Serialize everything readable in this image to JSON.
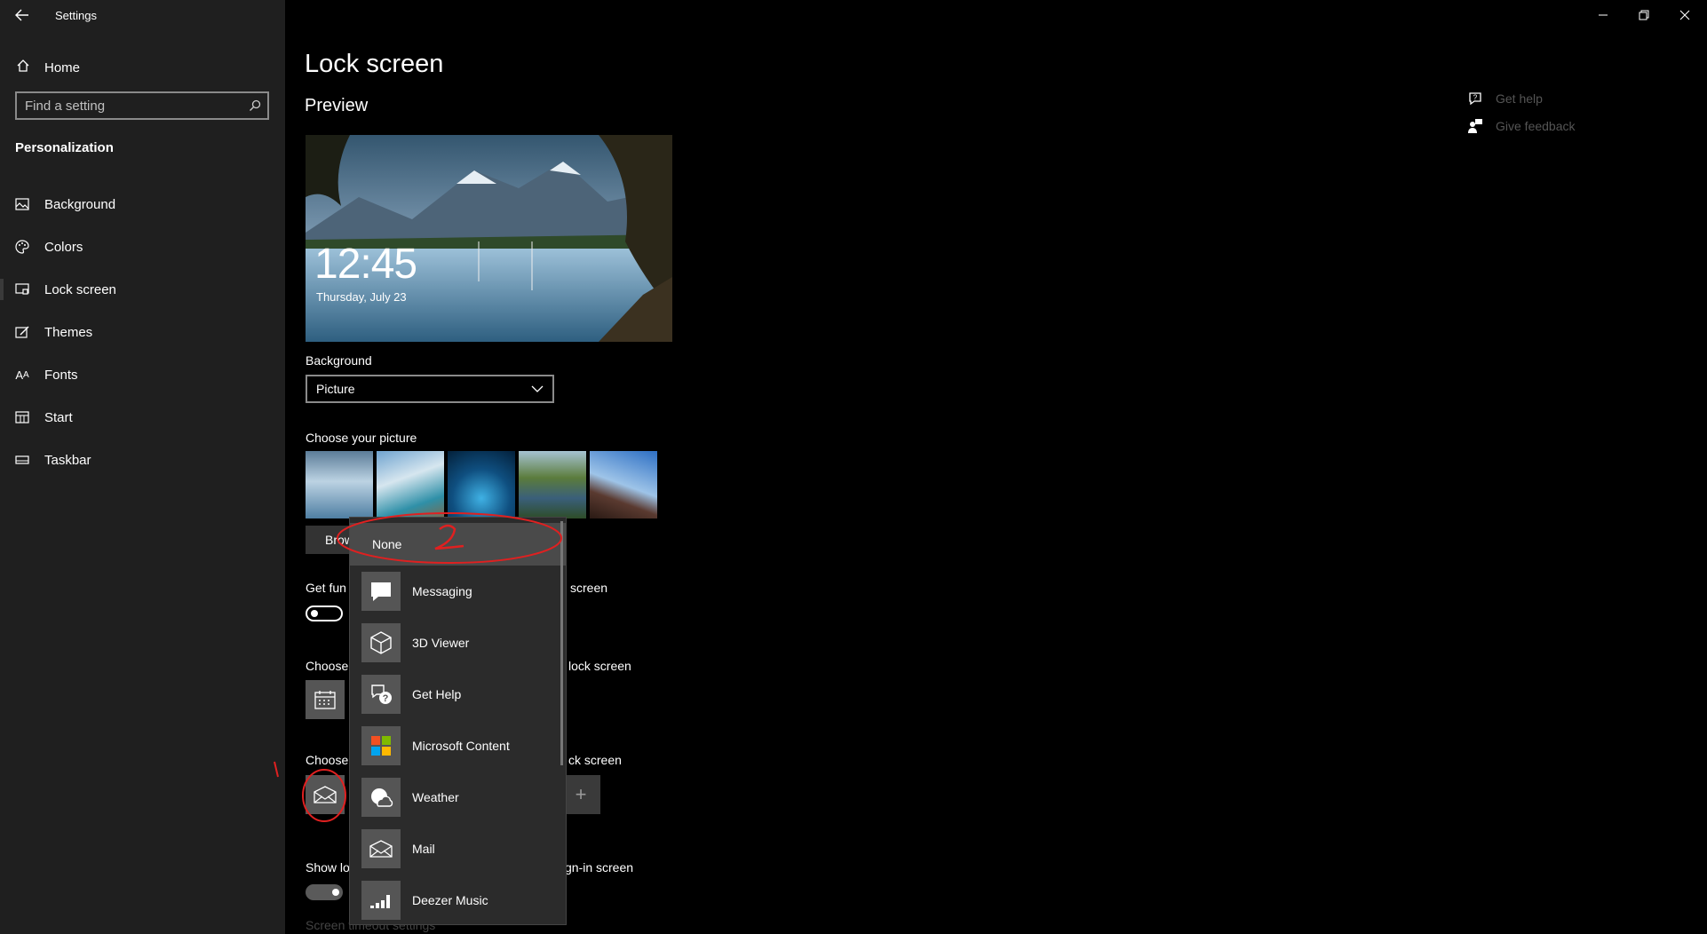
{
  "window": {
    "title": "Settings",
    "minimize_glyph": "—",
    "maximize_glyph": "❐",
    "close_glyph": "✕"
  },
  "sidebar": {
    "home_label": "Home",
    "search_placeholder": "Find a setting",
    "section_title": "Personalization",
    "items": [
      {
        "label": "Background",
        "icon": "image-icon"
      },
      {
        "label": "Colors",
        "icon": "palette-icon"
      },
      {
        "label": "Lock screen",
        "icon": "lock-screen-icon",
        "active": true
      },
      {
        "label": "Themes",
        "icon": "themes-icon"
      },
      {
        "label": "Fonts",
        "icon": "fonts-icon"
      },
      {
        "label": "Start",
        "icon": "start-icon"
      },
      {
        "label": "Taskbar",
        "icon": "taskbar-icon"
      }
    ]
  },
  "main": {
    "title": "Lock screen",
    "preview_label": "Preview",
    "preview_time": "12:45",
    "preview_date": "Thursday, July 23",
    "background_label": "Background",
    "background_value": "Picture",
    "choose_picture_label": "Choose your picture",
    "browse_label": "Browse",
    "get_fun_label_left": "Get fun",
    "get_fun_label_right": "screen",
    "choose_detailed_left": "Choose",
    "choose_detailed_right": "lock screen",
    "choose_quick_left": "Choose",
    "choose_quick_right": "ck screen",
    "show_bg_left": "Show lo",
    "show_bg_right": "gn-in screen",
    "screen_timeout_partial": "Screen timeout settings"
  },
  "right_panel": {
    "get_help": "Get help",
    "give_feedback": "Give feedback"
  },
  "popup": {
    "none_label": "None",
    "items": [
      {
        "label": "Messaging",
        "icon": "messaging-icon"
      },
      {
        "label": "3D Viewer",
        "icon": "3d-viewer-icon"
      },
      {
        "label": "Get Help",
        "icon": "get-help-icon"
      },
      {
        "label": "Microsoft Content",
        "icon": "microsoft-content-icon"
      },
      {
        "label": "Weather",
        "icon": "weather-icon"
      },
      {
        "label": "Mail",
        "icon": "mail-icon"
      },
      {
        "label": "Deezer Music",
        "icon": "deezer-music-icon"
      }
    ]
  },
  "annotations": {
    "mark_1": "1",
    "mark_2": "2",
    "color": "#e02020"
  }
}
